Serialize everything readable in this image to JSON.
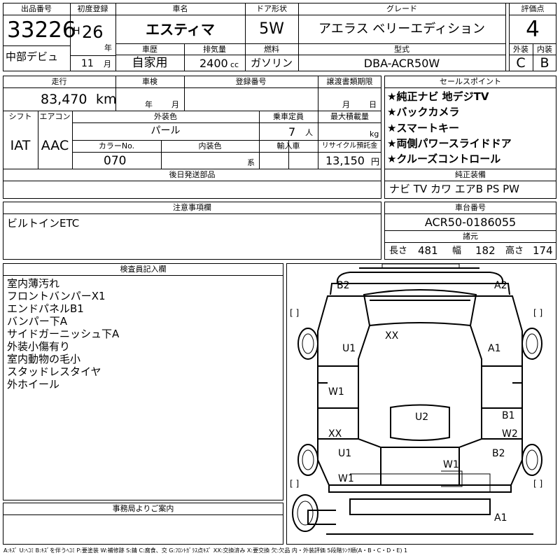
{
  "header": {
    "lot_label": "出品番号",
    "lot_number": "33226",
    "first_reg_label": "初度登録",
    "era": "H",
    "reg_year": "26",
    "year_unit": "年",
    "car_name_label": "車名",
    "car_name": "エスティマ",
    "door_label": "ドア形状",
    "door": "5W",
    "grade_label": "グレード",
    "grade": "アエラス ベリーエディション",
    "score_label": "評価点",
    "score": "4",
    "venue": "中部デビュ",
    "reg_month": "11",
    "month_unit": "月",
    "history_label": "車歴",
    "history": "自家用",
    "displacement_label": "排気量",
    "displacement": "2400",
    "cc_unit": "cc",
    "fuel_label": "燃料",
    "fuel": "ガソリン",
    "model_label": "型式",
    "model": "DBA-ACR50W",
    "ext_grade_label": "外装",
    "ext_grade": "C",
    "int_grade_label": "内装",
    "int_grade": "B"
  },
  "specs": {
    "mileage_label": "走行",
    "mileage": "83,470",
    "mileage_unit": "km",
    "inspection_label": "車検",
    "insp_year_unit": "年",
    "insp_month_unit": "月",
    "reg_no_label": "登録番号",
    "transfer_label": "譲渡書類期限",
    "transfer_month_unit": "月",
    "transfer_day_unit": "日",
    "shift_label": "シフト",
    "shift": "IAT",
    "ac_label": "エアコン",
    "ac": "AAC",
    "ext_color_label": "外装色",
    "ext_color": "パール",
    "capacity_label": "乗車定員",
    "capacity": "7",
    "capacity_unit": "人",
    "load_label": "最大積載量",
    "load_unit": "kg",
    "color_no_label": "カラーNo.",
    "color_no": "070",
    "int_color_label": "内装色",
    "int_color_suffix": "系",
    "import_label": "輸入車",
    "recycle_label": "リサイクル預託金",
    "recycle": "13,150",
    "recycle_unit": "円",
    "later_parts_label": "後日発送部品"
  },
  "sales_points": {
    "label": "セールスポイント",
    "items": [
      "★純正ナビ 地デジTV",
      "★バックカメラ",
      "★スマートキー",
      "★両側パワースライドドア",
      "★クルーズコントロール"
    ]
  },
  "equipment": {
    "label": "純正装備",
    "value": "ナビ TV カワ エアB PS PW"
  },
  "notes": {
    "label": "注意事項欄",
    "value": "ビルトインETC"
  },
  "chassis": {
    "label": "車台番号",
    "value": "ACR50-0186055"
  },
  "dimensions": {
    "label": "諸元",
    "length_label": "長さ",
    "length": "481",
    "width_label": "幅",
    "width": "182",
    "height_label": "高さ",
    "height": "174"
  },
  "inspector": {
    "label": "検査員記入欄",
    "lines": [
      "室内薄汚れ",
      "フロントバンパーX1",
      "エンドパネルB1",
      "バンパー下A",
      "サイドガーニッシュ下A",
      "外装小傷有り",
      "室内動物の毛小",
      "スタッドレスタイヤ",
      "外ホイール"
    ]
  },
  "office": {
    "label": "事務局よりご案内"
  },
  "diagram_marks": {
    "b2_top": "B2",
    "a2_top": "A2",
    "xx_roof": "XX",
    "u1_left": "U1",
    "a1_right": "A1",
    "w1_left": "W1",
    "u2_center": "U2",
    "b1_right": "B1",
    "xx_left": "XX",
    "w2_right": "W2",
    "u1_left_rear": "U1",
    "b2_right": "B2",
    "w1_center": "W1",
    "w1_left_rear": "W1",
    "a1_bottom": "A1",
    "bracket": "[ ]"
  },
  "legend": "A:ｷｽﾞ U:ﾍｺﾐ B:ｷｽﾞを伴うﾍｺﾐ P:要塗装 W:補修跡 S:錆 C:腐食、交 G:ﾌﾛﾝﾄｶﾞﾗｽ点ｷｽﾞ XX:交換済み X:要交換 欠:欠品 内・外装評価 5段階ﾗﾝｸ順(A・B・C・D・E) 1"
}
